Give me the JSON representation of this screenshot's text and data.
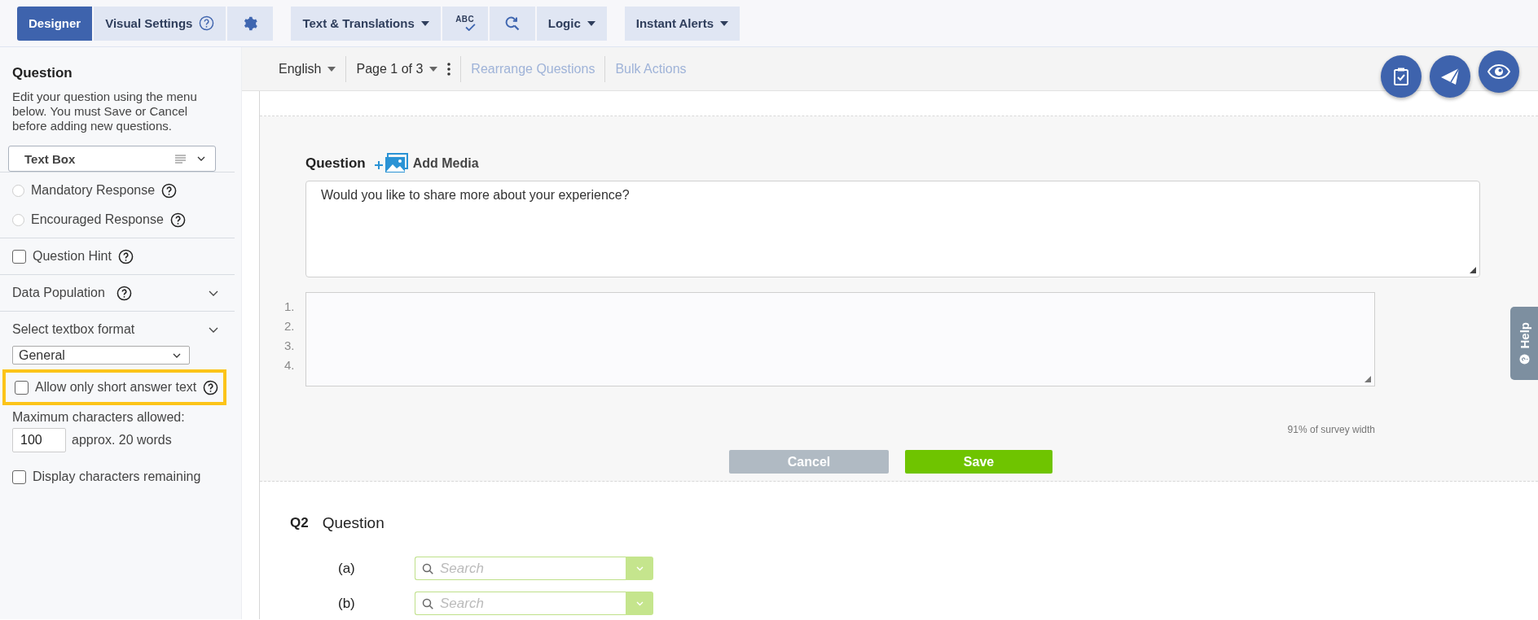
{
  "top_toolbar": [
    {
      "kind": "tab",
      "label": "Designer",
      "selected": true
    },
    {
      "kind": "tab",
      "label": "Visual Settings",
      "selected": false,
      "help": true
    },
    {
      "kind": "gear"
    },
    {
      "kind": "dropdown",
      "label": "Text & Translations",
      "joined": true
    },
    {
      "kind": "spellcheck",
      "label": "ABC",
      "joined": true
    },
    {
      "kind": "find"
    },
    {
      "kind": "dropdown",
      "label": "Logic"
    },
    {
      "kind": "dropdown",
      "label": "Instant Alerts"
    }
  ],
  "sub_toolbar": {
    "language": "English",
    "page": "Page 1 of 3",
    "links": [
      {
        "label": "Rearrange Questions",
        "disabled": true
      },
      {
        "label": "Bulk Actions",
        "disabled": true
      }
    ]
  },
  "sidebar": {
    "title": "Question",
    "description": "Edit your question using the menu below. You must Save or Cancel before adding new questions.",
    "type_select": "Text Box",
    "groups": [
      [
        {
          "kind": "radio",
          "label": "Mandatory Response",
          "checked": false,
          "help": true
        },
        {
          "kind": "radio",
          "label": "Encouraged Response",
          "checked": false,
          "help": true
        }
      ],
      [
        {
          "kind": "checkbox",
          "label": "Question Hint",
          "checked": false,
          "help": true
        }
      ],
      [
        {
          "kind": "section",
          "label": "Data Population",
          "help": true
        }
      ],
      [
        {
          "kind": "section",
          "label": "Select textbox format",
          "help": false
        },
        {
          "kind": "select",
          "value": "General"
        },
        {
          "kind": "checkbox",
          "label": "Allow only short answer text",
          "checked": false,
          "help": true,
          "highlighted": true
        },
        {
          "kind": "number",
          "label": "Maximum characters allowed:",
          "value": "100",
          "note": "approx. 20 words"
        },
        {
          "kind": "checkbox",
          "label": "Display characters remaining",
          "checked": false,
          "help": false
        }
      ]
    ]
  },
  "editor": {
    "question_label": "Question",
    "add_media": "Add Media",
    "question_text": "Would you like to share more about your experience?",
    "line_numbers": [
      "1.",
      "2.",
      "3.",
      "4."
    ],
    "width_note": "91% of survey width",
    "buttons": [
      {
        "kind": "cancel",
        "label": "Cancel"
      },
      {
        "kind": "save",
        "label": "Save"
      }
    ]
  },
  "q2": {
    "number": "Q2",
    "title": "Question",
    "rows": [
      {
        "label": "(a)",
        "placeholder": "Search"
      },
      {
        "label": "(b)",
        "placeholder": "Search"
      }
    ]
  },
  "help_tab": "Help"
}
